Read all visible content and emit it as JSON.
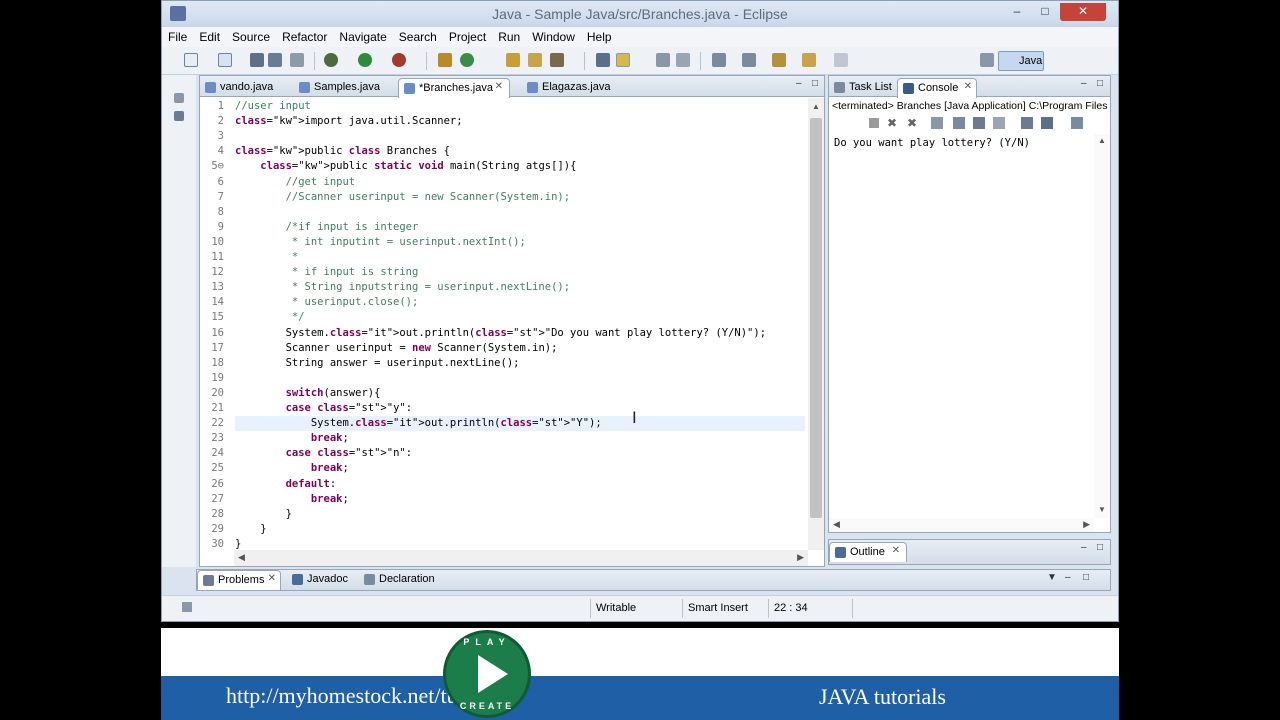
{
  "window": {
    "title": "Java - Sample Java/src/Branches.java - Eclipse"
  },
  "menu": [
    "File",
    "Edit",
    "Source",
    "Refactor",
    "Navigate",
    "Search",
    "Project",
    "Run",
    "Window",
    "Help"
  ],
  "perspective": "Java",
  "editor_tabs": [
    {
      "label": "vando.java",
      "active": false
    },
    {
      "label": "Samples.java",
      "active": false
    },
    {
      "label": "*Branches.java",
      "active": true
    },
    {
      "label": "Elagazas.java",
      "active": false
    }
  ],
  "code_lines": [
    {
      "n": "1",
      "text": "//user input"
    },
    {
      "n": "2",
      "text": "import java.util.Scanner;"
    },
    {
      "n": "3",
      "text": ""
    },
    {
      "n": "4",
      "text": "public class Branches {"
    },
    {
      "n": "5⊖",
      "text": "    public static void main(String atgs[]){"
    },
    {
      "n": "6",
      "text": "        //get input"
    },
    {
      "n": "7",
      "text": "        //Scanner userinput = new Scanner(System.in);"
    },
    {
      "n": "8",
      "text": ""
    },
    {
      "n": "9",
      "text": "        /*if input is integer"
    },
    {
      "n": "10",
      "text": "         * int inputint = userinput.nextInt();"
    },
    {
      "n": "11",
      "text": "         *"
    },
    {
      "n": "12",
      "text": "         * if input is string"
    },
    {
      "n": "13",
      "text": "         * String inputstring = userinput.nextLine();"
    },
    {
      "n": "14",
      "text": "         * userinput.close();"
    },
    {
      "n": "15",
      "text": "         */"
    },
    {
      "n": "16",
      "text": "        System.out.println(\"Do you want play lottery? (Y/N)\");"
    },
    {
      "n": "17",
      "text": "        Scanner userinput = new Scanner(System.in);"
    },
    {
      "n": "18",
      "text": "        String answer = userinput.nextLine();"
    },
    {
      "n": "19",
      "text": ""
    },
    {
      "n": "20",
      "text": "        switch(answer){"
    },
    {
      "n": "21",
      "text": "        case \"y\":"
    },
    {
      "n": "22",
      "text": "            System.out.println(\"Y\");"
    },
    {
      "n": "23",
      "text": "            break;"
    },
    {
      "n": "24",
      "text": "        case \"n\":"
    },
    {
      "n": "25",
      "text": "            break;"
    },
    {
      "n": "26",
      "text": "        default:"
    },
    {
      "n": "27",
      "text": "            break;"
    },
    {
      "n": "28",
      "text": "        }"
    },
    {
      "n": "29",
      "text": "    }"
    },
    {
      "n": "30",
      "text": "}"
    }
  ],
  "right_tabs": [
    {
      "label": "Task List",
      "active": false
    },
    {
      "label": "Console",
      "active": true
    }
  ],
  "console": {
    "header": "<terminated> Branches [Java Application] C:\\Program Files",
    "output": "Do you want play lottery? (Y/N)"
  },
  "outline_tab": "Outline",
  "bottom_tabs": [
    "Problems",
    "Javadoc",
    "Declaration"
  ],
  "status": {
    "mode": "Writable",
    "insert": "Smart Insert",
    "position": "22 : 34"
  },
  "footer": {
    "url": "http://myhomestock.net/tutorial/",
    "title": "JAVA tutorials",
    "logo_top": "PLAY",
    "logo_bottom": "CREATE"
  }
}
